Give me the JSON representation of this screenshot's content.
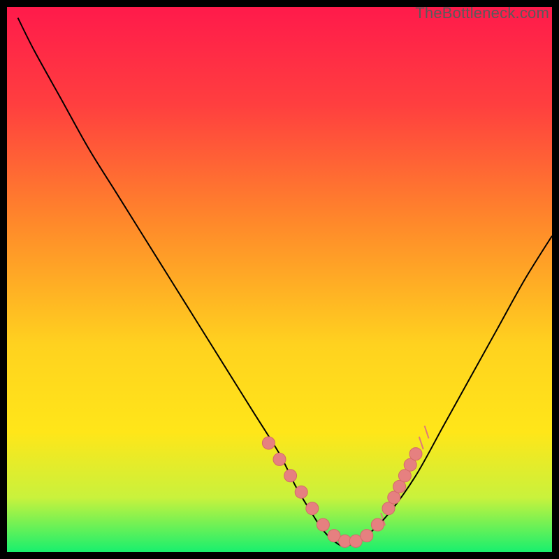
{
  "watermark": "TheBottleneck.com",
  "chart_data": {
    "type": "line",
    "title": "",
    "xlabel": "",
    "ylabel": "",
    "xlim": [
      0,
      100
    ],
    "ylim": [
      0,
      100
    ],
    "grid": false,
    "legend": false,
    "background_gradient": {
      "top": "#ff1a4b",
      "mid": "#ffe619",
      "bottom": "#18f06e"
    },
    "series": [
      {
        "name": "bottleneck-curve",
        "x": [
          2,
          5,
          10,
          15,
          20,
          25,
          30,
          35,
          40,
          45,
          50,
          53,
          56,
          58,
          60,
          62,
          64,
          66,
          70,
          75,
          80,
          85,
          90,
          95,
          100
        ],
        "y": [
          98,
          92,
          83,
          74,
          66,
          58,
          50,
          42,
          34,
          26,
          18,
          12,
          7,
          4,
          2,
          1,
          2,
          3,
          7,
          14,
          23,
          32,
          41,
          50,
          58
        ]
      }
    ],
    "highlight_points": {
      "name": "highlight-points",
      "x": [
        48,
        50,
        52,
        54,
        56,
        58,
        60,
        62,
        64,
        66,
        68,
        70,
        71,
        72,
        73,
        74,
        75
      ],
      "y": [
        20,
        17,
        14,
        11,
        8,
        5,
        3,
        2,
        2,
        3,
        5,
        8,
        10,
        12,
        14,
        16,
        18
      ]
    },
    "highlight_ticks": {
      "name": "highlight-ticks",
      "x": [
        68,
        69,
        70,
        71,
        72,
        73,
        74,
        75,
        76,
        77
      ],
      "y": [
        5,
        6,
        8,
        10,
        12,
        14,
        16,
        18,
        20,
        22
      ]
    }
  }
}
